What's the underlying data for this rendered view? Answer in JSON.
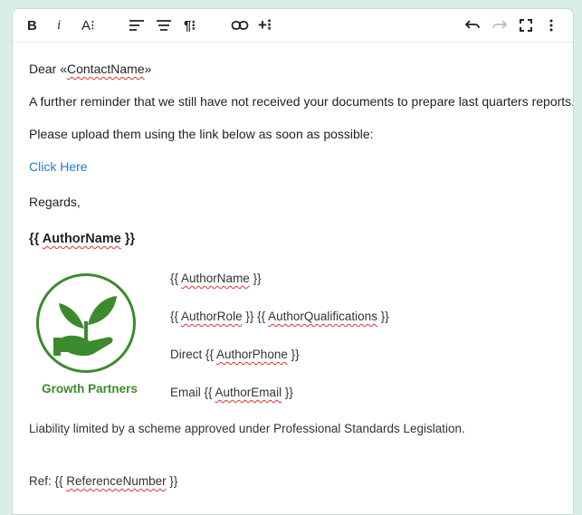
{
  "toolbar": {
    "bold_label": "B",
    "italic_label": "i",
    "font_size_label": "A⁝",
    "align_left_icon": "align-left-icon",
    "align_center_icon": "align-center-icon",
    "paragraph_label": "¶⁝",
    "link_icon": "link-icon",
    "insert_label": "+⁝",
    "undo_icon": "undo-icon",
    "redo_icon": "redo-icon",
    "fullscreen_icon": "fullscreen-icon",
    "more_icon": "more-icon"
  },
  "email": {
    "greeting_prefix": "Dear «",
    "greeting_tag": "ContactName",
    "greeting_suffix": "»",
    "line1": "A further reminder that we still have not received your documents to prepare last quarters reports.",
    "line2": "Please upload them using the link below as soon as possible:",
    "link_text": "Click Here",
    "regards": "Regards,",
    "author_head_open": "{{ ",
    "author_head_tag": "AuthorName",
    "author_head_close": " }}",
    "sig_name_open": "{{ ",
    "sig_name_tag": "AuthorName",
    "sig_name_close": " }}",
    "sig_role_open": "{{ ",
    "sig_role_tag": "AuthorRole",
    "sig_role_mid": " }} {{ ",
    "sig_qual_tag": "AuthorQualifications",
    "sig_role_close": " }}",
    "sig_phone_prefix": "Direct {{ ",
    "sig_phone_tag": "AuthorPhone",
    "sig_phone_close": " }}",
    "sig_email_prefix": "Email {{ ",
    "sig_email_tag": "AuthorEmail",
    "sig_email_close": " }}",
    "logo_name": "Growth Partners",
    "liability": " Liability limited by a scheme approved under Professional Standards Legislation.",
    "ref_prefix": "Ref: {{ ",
    "ref_tag": "ReferenceNumber",
    "ref_close": " }}"
  },
  "colors": {
    "background": "#d9efe5",
    "link": "#1f7ad1",
    "logo_green": "#3c8a2e"
  }
}
